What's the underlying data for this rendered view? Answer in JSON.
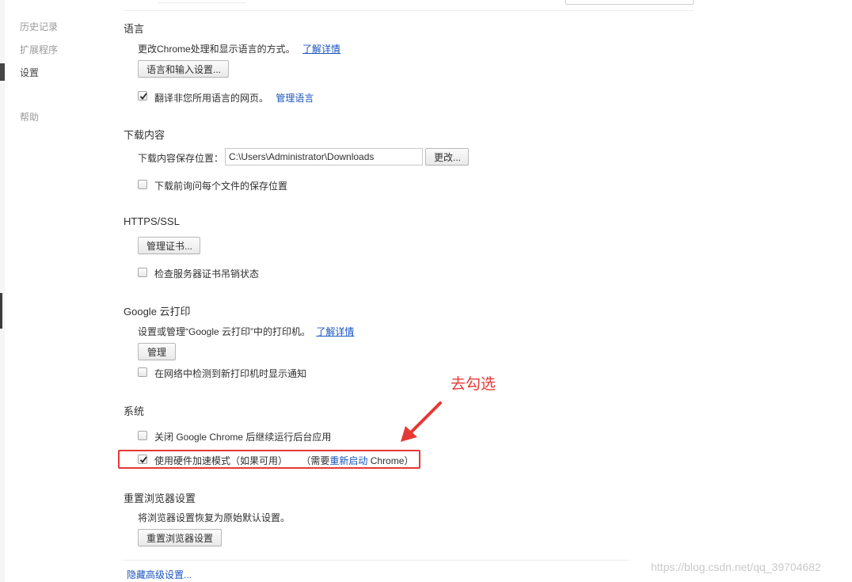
{
  "sidebar": {
    "items": [
      {
        "label": "历史记录"
      },
      {
        "label": "扩展程序"
      },
      {
        "label": "设置"
      },
      {
        "label": "帮助"
      }
    ]
  },
  "sections": {
    "language": {
      "title": "语言",
      "description": "更改Chrome处理和显示语言的方式。",
      "learn_more": "了解详情",
      "button": "语言和输入设置...",
      "translate_label": "翻译非您所用语言的网页。",
      "translate_checked": true,
      "manage_languages": "管理语言"
    },
    "downloads": {
      "title": "下载内容",
      "location_label": "下载内容保存位置：",
      "location_value": "C:\\Users\\Administrator\\Downloads",
      "change_button": "更改...",
      "ask_label": "下载前询问每个文件的保存位置",
      "ask_checked": false
    },
    "https": {
      "title": "HTTPS/SSL",
      "button": "管理证书...",
      "revocation_label": "检查服务器证书吊销状态",
      "revocation_checked": false
    },
    "cloud_print": {
      "title": "Google 云打印",
      "description": "设置或管理“Google 云打印”中的打印机。",
      "learn_more": "了解详情",
      "button": "管理",
      "notify_label": "在网络中检测到新打印机时显示通知",
      "notify_checked": false
    },
    "system": {
      "title": "系统",
      "background_label": "关闭 Google Chrome 后继续运行后台应用",
      "background_checked": false,
      "hw_accel_label": "使用硬件加速模式（如果可用）",
      "hw_accel_checked": true,
      "hw_note_prefix": "（需要",
      "hw_note_link": "重新启动",
      "hw_note_suffix": " Chrome）"
    },
    "reset": {
      "title": "重置浏览器设置",
      "description": "将浏览器设置恢复为原始默认设置。",
      "button": "重置浏览器设置"
    }
  },
  "footer": {
    "hide_advanced": "隐藏高级设置..."
  },
  "annotation": {
    "text": "去勾选",
    "color": "#e53935"
  },
  "watermark": "https://blog.csdn.net/qq_39704682",
  "colors": {
    "link": "#1a55c0",
    "text": "#303030",
    "nav_inactive": "#999999",
    "highlight": "#e53935"
  },
  "icons": {
    "checkbox_checked": "checkmark-icon",
    "annotation_arrow": "arrow-icon"
  }
}
